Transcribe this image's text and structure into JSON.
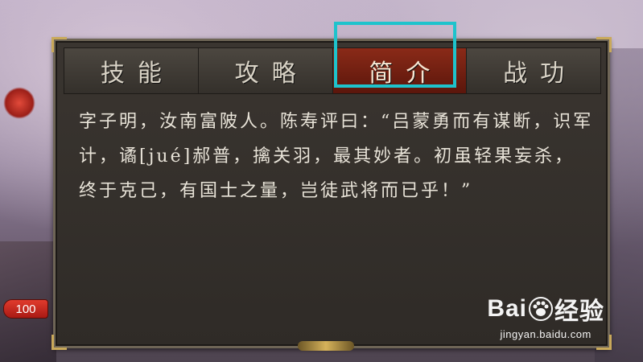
{
  "level_badge": "100",
  "tabs": [
    {
      "label": "技能",
      "active": false
    },
    {
      "label": "攻略",
      "active": false
    },
    {
      "label": "简介",
      "active": true
    },
    {
      "label": "战功",
      "active": false
    }
  ],
  "intro_text": "字子明，汝南富陂人。陈寿评曰：“吕蒙勇而有谋断，识军计，谲[jué]郝普，擒关羽，最其妙者。初虽轻果妄杀，终于克己，有国士之量，岂徒武将而已乎！”",
  "watermark": {
    "logo_left": "Bai",
    "logo_right": "经验",
    "url": "jingyan.baidu.com"
  },
  "colors": {
    "active_tab": "#8a2a18",
    "highlight_box": "#1ec3cc",
    "panel_bg": "#34302b",
    "text": "#e8e3d8"
  }
}
